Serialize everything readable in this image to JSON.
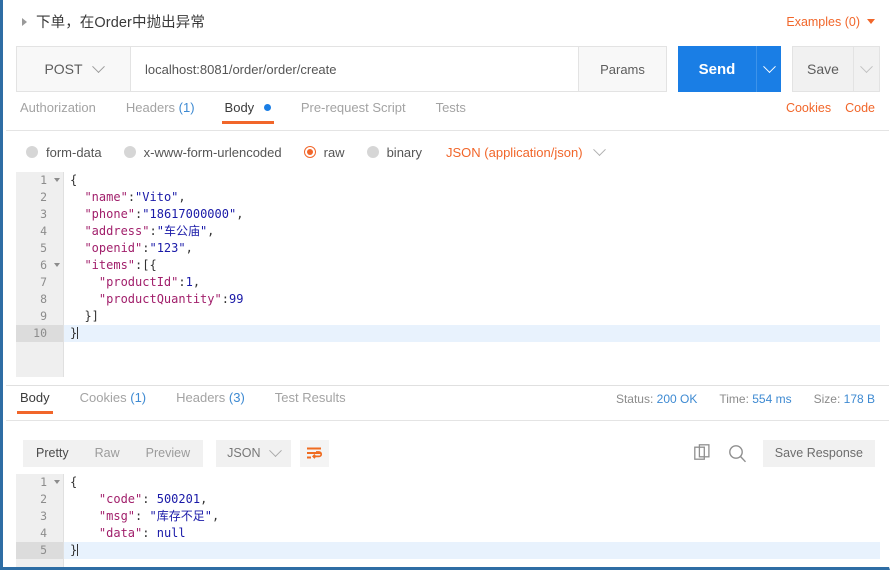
{
  "request": {
    "title": "下单，在Order中抛出异常",
    "examples_label": "Examples (0)",
    "method": "POST",
    "url": "localhost:8081/order/order/create",
    "params_label": "Params",
    "send_label": "Send",
    "save_label": "Save",
    "tabs": [
      {
        "label": "Authorization",
        "count": "",
        "active": false,
        "dot": false
      },
      {
        "label": "Headers",
        "count": "(1)",
        "active": false,
        "dot": false
      },
      {
        "label": "Body",
        "count": "",
        "active": true,
        "dot": true
      },
      {
        "label": "Pre-request Script",
        "count": "",
        "active": false,
        "dot": false
      },
      {
        "label": "Tests",
        "count": "",
        "active": false,
        "dot": false
      }
    ],
    "tabs_right": [
      "Cookies",
      "Code"
    ],
    "body_types": [
      {
        "label": "form-data",
        "selected": false
      },
      {
        "label": "x-www-form-urlencoded",
        "selected": false
      },
      {
        "label": "raw",
        "selected": true
      },
      {
        "label": "binary",
        "selected": false
      }
    ],
    "content_type": "JSON (application/json)",
    "body_lines": [
      {
        "no": "1",
        "fold": true,
        "current": false,
        "tokens": [
          {
            "t": "p",
            "v": "{"
          }
        ]
      },
      {
        "no": "2",
        "fold": false,
        "current": false,
        "tokens": [
          {
            "t": "p",
            "v": "  "
          },
          {
            "t": "k",
            "v": "\"name\""
          },
          {
            "t": "p",
            "v": ":"
          },
          {
            "t": "s",
            "v": "\"Vito\""
          },
          {
            "t": "p",
            "v": ","
          }
        ]
      },
      {
        "no": "3",
        "fold": false,
        "current": false,
        "tokens": [
          {
            "t": "p",
            "v": "  "
          },
          {
            "t": "k",
            "v": "\"phone\""
          },
          {
            "t": "p",
            "v": ":"
          },
          {
            "t": "s",
            "v": "\"18617000000\""
          },
          {
            "t": "p",
            "v": ","
          }
        ]
      },
      {
        "no": "4",
        "fold": false,
        "current": false,
        "tokens": [
          {
            "t": "p",
            "v": "  "
          },
          {
            "t": "k",
            "v": "\"address\""
          },
          {
            "t": "p",
            "v": ":"
          },
          {
            "t": "s",
            "v": "\"车公庙\""
          },
          {
            "t": "p",
            "v": ","
          }
        ]
      },
      {
        "no": "5",
        "fold": false,
        "current": false,
        "tokens": [
          {
            "t": "p",
            "v": "  "
          },
          {
            "t": "k",
            "v": "\"openid\""
          },
          {
            "t": "p",
            "v": ":"
          },
          {
            "t": "s",
            "v": "\"123\""
          },
          {
            "t": "p",
            "v": ","
          }
        ]
      },
      {
        "no": "6",
        "fold": true,
        "current": false,
        "tokens": [
          {
            "t": "p",
            "v": "  "
          },
          {
            "t": "k",
            "v": "\"items\""
          },
          {
            "t": "p",
            "v": ":[{"
          }
        ]
      },
      {
        "no": "7",
        "fold": false,
        "current": false,
        "tokens": [
          {
            "t": "p",
            "v": "    "
          },
          {
            "t": "k",
            "v": "\"productId\""
          },
          {
            "t": "p",
            "v": ":"
          },
          {
            "t": "n",
            "v": "1"
          },
          {
            "t": "p",
            "v": ","
          }
        ]
      },
      {
        "no": "8",
        "fold": false,
        "current": false,
        "tokens": [
          {
            "t": "p",
            "v": "    "
          },
          {
            "t": "k",
            "v": "\"productQuantity\""
          },
          {
            "t": "p",
            "v": ":"
          },
          {
            "t": "n",
            "v": "99"
          }
        ]
      },
      {
        "no": "9",
        "fold": false,
        "current": false,
        "tokens": [
          {
            "t": "p",
            "v": "  }]"
          }
        ]
      },
      {
        "no": "10",
        "fold": false,
        "current": true,
        "tokens": [
          {
            "t": "p",
            "v": "}"
          }
        ]
      }
    ]
  },
  "response": {
    "tabs": [
      {
        "label": "Body",
        "count": "",
        "active": true
      },
      {
        "label": "Cookies",
        "count": "(1)",
        "active": false
      },
      {
        "label": "Headers",
        "count": "(3)",
        "active": false
      },
      {
        "label": "Test Results",
        "count": "",
        "active": false
      }
    ],
    "status_label": "Status:",
    "status_value": "200 OK",
    "time_label": "Time:",
    "time_value": "554 ms",
    "size_label": "Size:",
    "size_value": "178 B",
    "view_modes": [
      {
        "label": "Pretty",
        "active": true
      },
      {
        "label": "Raw",
        "active": false
      },
      {
        "label": "Preview",
        "active": false
      }
    ],
    "format": "JSON",
    "save_response_label": "Save Response",
    "body_lines": [
      {
        "no": "1",
        "fold": true,
        "current": false,
        "tokens": [
          {
            "t": "p",
            "v": "{"
          }
        ]
      },
      {
        "no": "2",
        "fold": false,
        "current": false,
        "tokens": [
          {
            "t": "p",
            "v": "    "
          },
          {
            "t": "k",
            "v": "\"code\""
          },
          {
            "t": "p",
            "v": ": "
          },
          {
            "t": "n",
            "v": "500201"
          },
          {
            "t": "p",
            "v": ","
          }
        ]
      },
      {
        "no": "3",
        "fold": false,
        "current": false,
        "tokens": [
          {
            "t": "p",
            "v": "    "
          },
          {
            "t": "k",
            "v": "\"msg\""
          },
          {
            "t": "p",
            "v": ": "
          },
          {
            "t": "s",
            "v": "\"库存不足\""
          },
          {
            "t": "p",
            "v": ","
          }
        ]
      },
      {
        "no": "4",
        "fold": false,
        "current": false,
        "tokens": [
          {
            "t": "p",
            "v": "    "
          },
          {
            "t": "k",
            "v": "\"data\""
          },
          {
            "t": "p",
            "v": ": "
          },
          {
            "t": "n",
            "v": "null"
          }
        ]
      },
      {
        "no": "5",
        "fold": false,
        "current": true,
        "tokens": [
          {
            "t": "p",
            "v": "}"
          }
        ]
      }
    ]
  },
  "colors": {
    "accent_orange": "#f1662a",
    "send_blue": "#1a7ee5",
    "link_blue": "#3e8ad2",
    "frame_blue": "#2e6da4"
  }
}
